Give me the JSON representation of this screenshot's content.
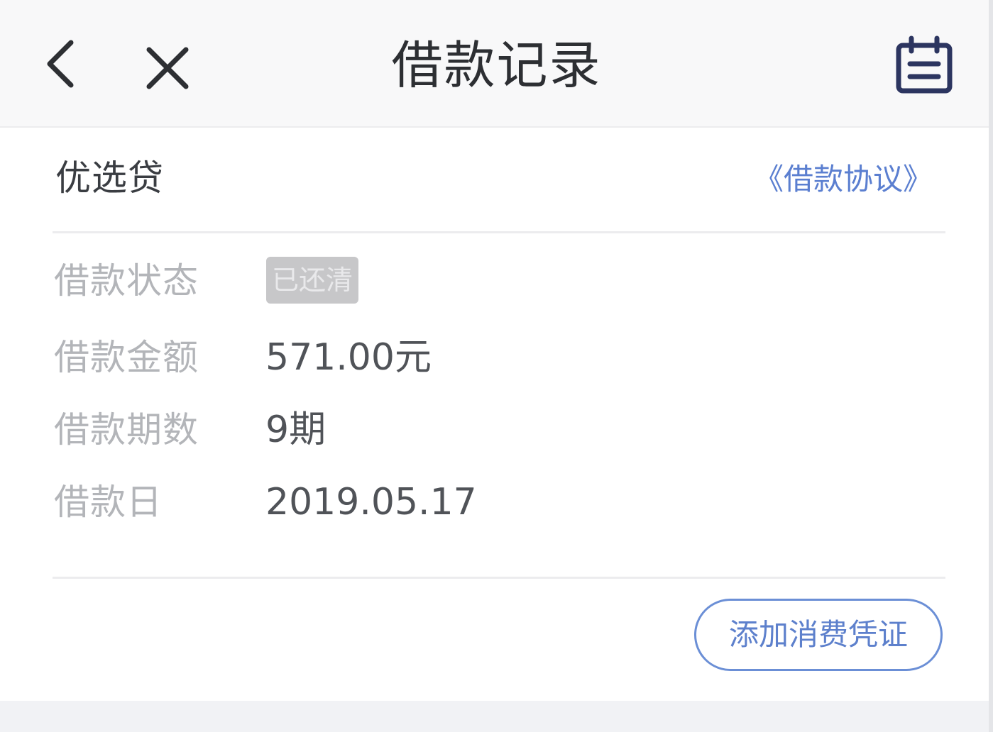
{
  "header": {
    "title": "借款记录",
    "back_icon": "chevron-left-icon",
    "close_icon": "close-icon",
    "record_icon": "calendar-icon"
  },
  "loan": {
    "product_name": "优选贷",
    "agreement_link": "《借款协议》",
    "status_label": "借款状态",
    "status_value": "已还清",
    "amount_label": "借款金额",
    "amount_value": "571.00元",
    "periods_label": "借款期数",
    "periods_value": "9期",
    "date_label": "借款日",
    "date_value": "2019.05.17"
  },
  "actions": {
    "add_voucher_label": "添加消费凭证"
  },
  "colors": {
    "accent_blue": "#5b7fd0",
    "badge_gray": "#c7c7c9",
    "title_text": "#2d2f33",
    "label_text": "#b3b5b9"
  }
}
